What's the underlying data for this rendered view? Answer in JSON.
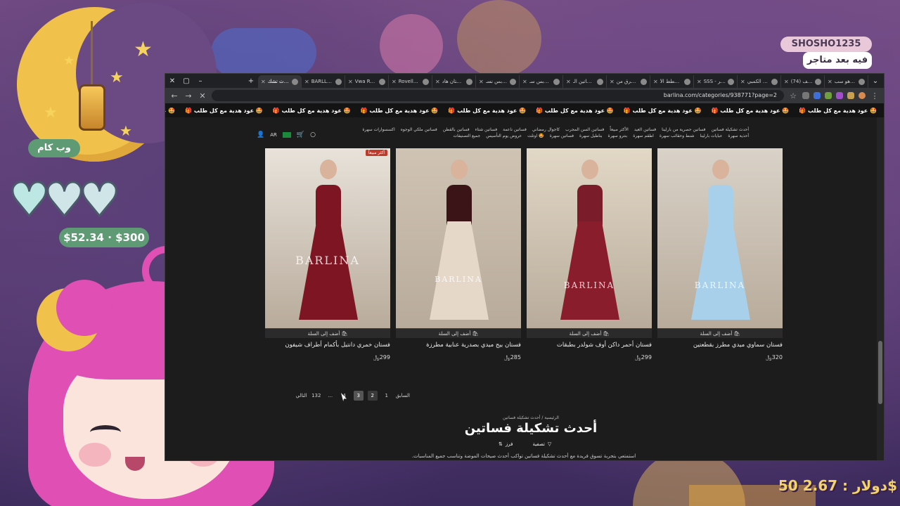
{
  "overlay": {
    "web_cam": "وب كام",
    "money": "$52.34 · $300",
    "name_tag": "SHOSHO1235",
    "name_sub": "فيه بعد متاجر",
    "donation": "50 دولار : 2.67$"
  },
  "browser": {
    "tabs": [
      {
        "label": "ما هو سب..."
      },
      {
        "label": "(74) كيف..."
      },
      {
        "label": "جهاز الكمبي..."
      },
      {
        "label": "SSS - سر..."
      },
      {
        "label": "المخطط الأ..."
      },
      {
        "label": "المرق من..."
      },
      {
        "label": "فساتين الـ..."
      },
      {
        "label": "ملابس سـ..."
      },
      {
        "label": "ملابس نسـ..."
      },
      {
        "label": "فستان هاد..."
      },
      {
        "label": "Rovella..."
      },
      {
        "label": "Vwa Rei..."
      },
      {
        "label": "BARLLINA..."
      },
      {
        "label": "أحدث تشك..."
      }
    ],
    "url": "barlina.com/categories/938771?page=2",
    "promo_text": "عود هدية مع كل طلب 🤩",
    "promo_count": 9
  },
  "site": {
    "nav_links": [
      "أحدث تشكيلة فساتين",
      "فساتين حصرية من بارلينا",
      "فساتين العيد",
      "الأكثر مبيعاً",
      "فساتين السن المجرب",
      "كاجوال رمضاني",
      "فساتين ناعمة",
      "فساتين شتاء",
      "فساتين بالقطن",
      "فساتين ملكي الوجوه",
      "اكسسوارات سهرة",
      "أحذية سهرة",
      "عبايات بارلينا",
      "شنط وحقائب سهرة",
      "اطقم سهرة",
      "بنترو سهرة",
      "بناطيل سهرة",
      "فساتين سهرة",
      "اوتلت 🤩",
      "عروض يوم التأسيس",
      "جميع التصنيفات"
    ],
    "lang": "AR",
    "products": [
      {
        "name": "فستان سماوي ميدي مطرز بقطعتين",
        "price": "320",
        "add": "أضف إلى السلة",
        "watermark": "BARLINA",
        "badge": ""
      },
      {
        "name": "فستان أحمر داكن أوف شولدر بطبقات",
        "price": "299",
        "add": "أضف إلى السلة",
        "watermark": "BARLINA",
        "badge": ""
      },
      {
        "name": "فستان بيج ميدي بصدرية عنابية مطرزة",
        "price": "285",
        "add": "أضف إلى السلة",
        "watermark": "BARLINA",
        "badge": ""
      },
      {
        "name": "فستان خمري دانتيل بأكمام أطراف شيفون",
        "price": "299",
        "add": "أضف إلى السلة",
        "watermark": "BARLINA",
        "badge": "أكثر مبيعاً"
      }
    ],
    "currency": "﷼",
    "pagination": {
      "prev": "السابق",
      "pages": [
        "1",
        "2",
        "3",
        "4",
        "...",
        "132"
      ],
      "next": "التالي",
      "current": "2",
      "hover": "3"
    },
    "breadcrumb": "الرئيسية / أحدث تشكيلة فساتين",
    "heading": "أحدث تشكيلة فساتين",
    "intro": "استمتعي بتجربة تسوق فريدة مع أحدث تشكيلة فساتين تواكب أحدث صيحات الموضة وتناسب جميع المناسبات.",
    "filter_label": "تصفية",
    "sort_label": "فرز"
  }
}
